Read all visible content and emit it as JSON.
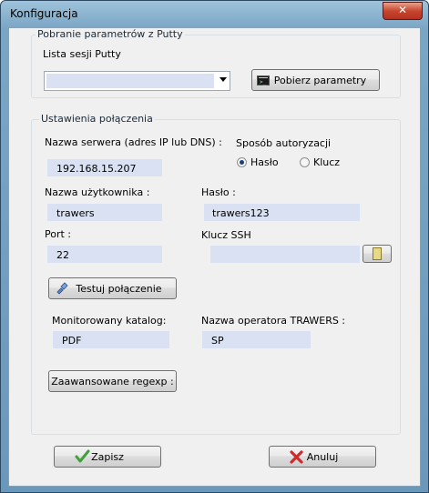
{
  "window": {
    "title": "Konfiguracja",
    "close_glyph": "✕"
  },
  "putty": {
    "group_label": "Pobranie parametrów z Putty",
    "session_label": "Lista sesji Putty",
    "session_value": "",
    "fetch_button": "Pobierz parametry"
  },
  "connection": {
    "group_label": "Ustawienia połączenia",
    "server_label": "Nazwa serwera (adres IP lub DNS) :",
    "server_value": "192.168.15.207",
    "auth_label": "Sposób autoryzacji",
    "auth_options": [
      {
        "label": "Hasło",
        "selected": true
      },
      {
        "label": "Klucz",
        "selected": false
      }
    ],
    "user_label": "Nazwa użytkownika :",
    "user_value": "trawers",
    "password_label": "Hasło :",
    "password_value": "trawers123",
    "port_label": "Port :",
    "port_value": "22",
    "ssh_key_label": "Klucz SSH",
    "ssh_key_value": "",
    "test_button": "Testuj połączenie",
    "monitored_label": "Monitorowany katalog:",
    "monitored_value": "PDF",
    "operator_label": "Nazwa operatora TRAWERS :",
    "operator_value": "SP",
    "regexp_button": "Zaawansowane regexp :"
  },
  "footer": {
    "save_button": "Zapisz",
    "cancel_button": "Anuluj"
  },
  "colors": {
    "field_bg": "#d9e1f2",
    "save_icon": "#3fa13a",
    "cancel_icon": "#d22a2a",
    "title_bar": "#7aa6c6"
  }
}
